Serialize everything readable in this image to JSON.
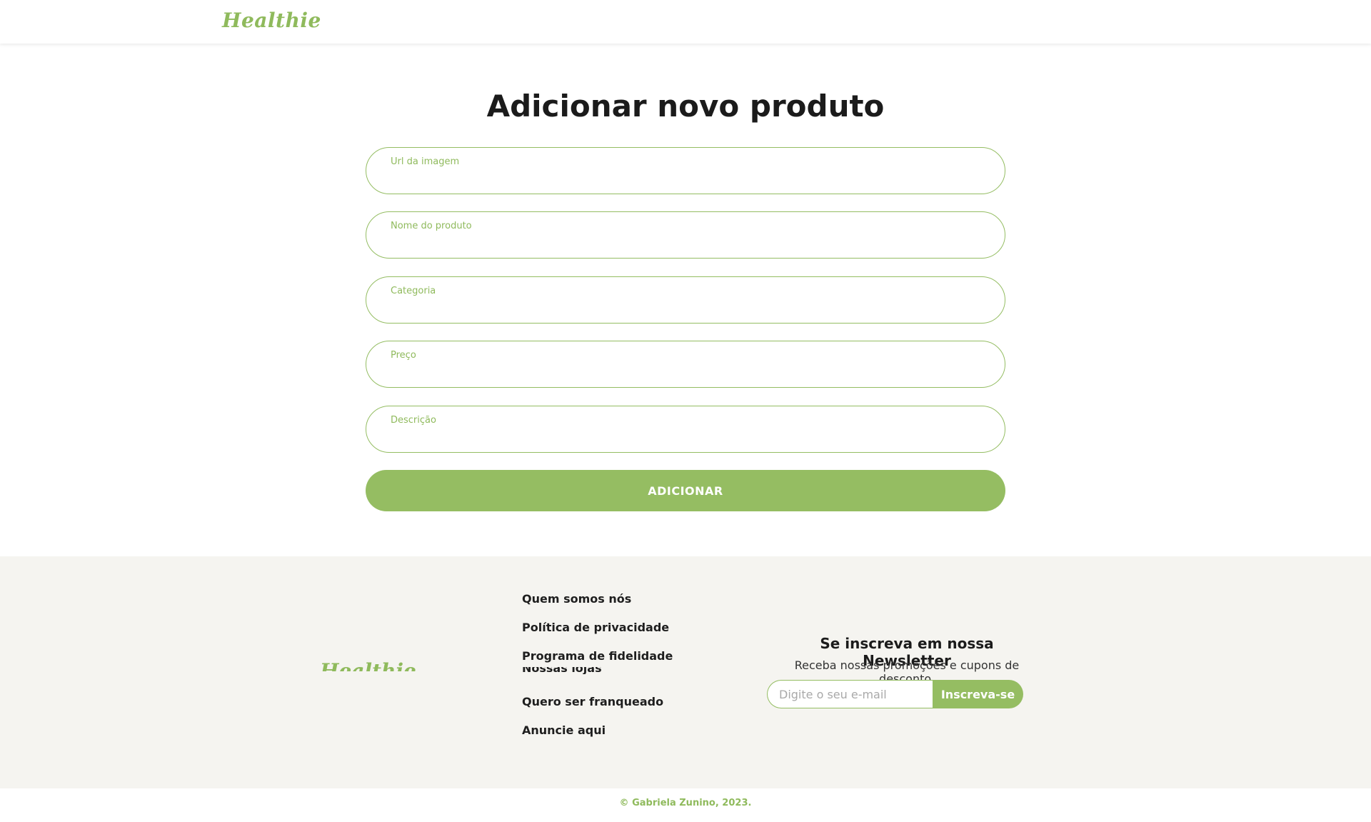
{
  "header": {
    "logo": "Healthie"
  },
  "main": {
    "title": "Adicionar novo produto",
    "fields": [
      {
        "label": "Url da imagem",
        "value": ""
      },
      {
        "label": "Nome do produto",
        "value": ""
      },
      {
        "label": "Categoria",
        "value": ""
      },
      {
        "label": "Preço",
        "value": ""
      },
      {
        "label": "Descrição",
        "value": ""
      }
    ],
    "submit_label": "ADICIONAR"
  },
  "footer": {
    "logo": "Healthie",
    "links": [
      "Quem somos nós",
      "Política de privacidade",
      "Programa de fidelidade",
      "Nossas lojas",
      "Quero ser franqueado",
      "Anuncie aqui"
    ],
    "newsletter": {
      "title": "Se inscreva em nossa Newsletter",
      "subtitle": "Receba nossas promoções e cupons de desconto.",
      "placeholder": "Digite o seu e-mail",
      "button_label": "Inscreva-se"
    },
    "copyright": "© Gabriela Zunino, 2023."
  },
  "colors": {
    "accent": "#95bd62",
    "footer_bg": "#f5f4f0",
    "text": "#1b1b1b"
  }
}
